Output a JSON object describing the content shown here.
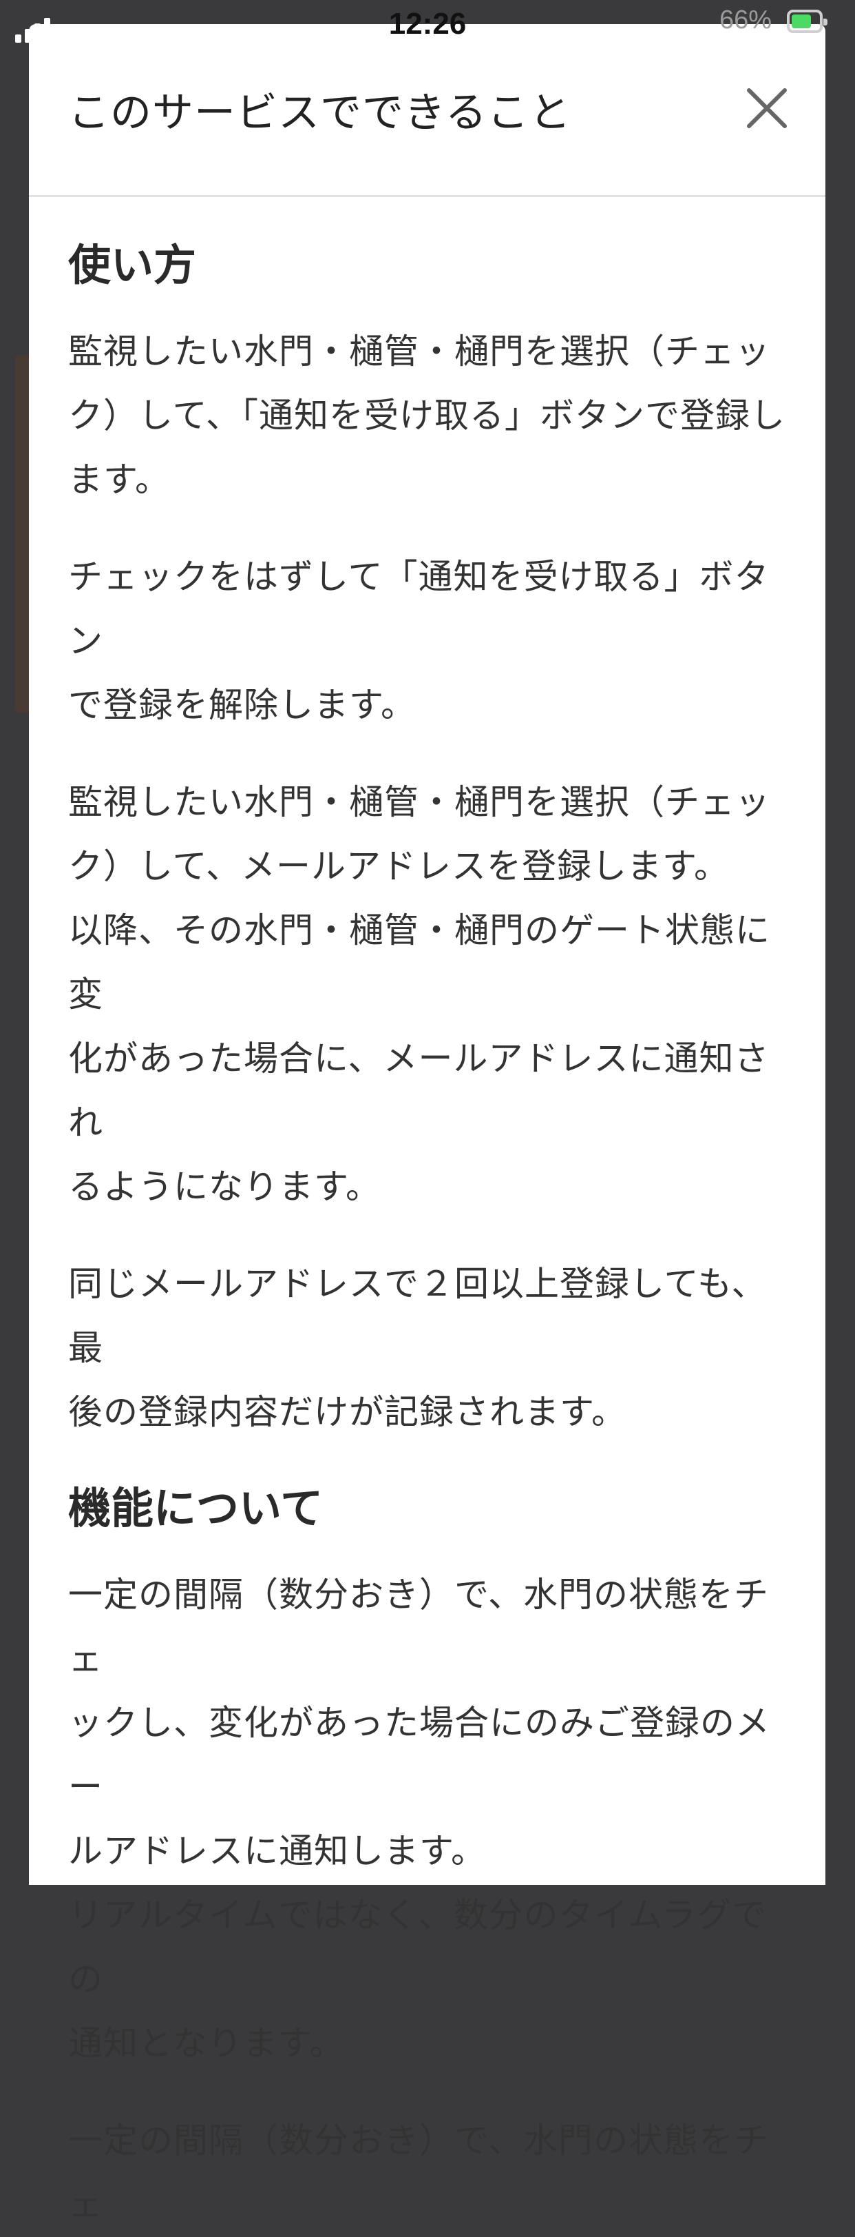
{
  "status_bar": {
    "time": "12:26",
    "battery_percent": "66%"
  },
  "modal": {
    "title": "このサービスでできること",
    "close_icon": "close-icon"
  },
  "sections": [
    {
      "heading": "使い方",
      "paragraphs": [
        "監視したい水門・樋管・樋門を選択（チェッ\nク）して、「通知を受け取る」ボタンで登録し\nます。",
        "チェックをはずして「通知を受け取る」ボタン\nで登録を解除します。",
        "監視したい水門・樋管・樋門を選択（チェッ\nク）して、メールアドレスを登録します。\n以降、その水門・樋管・樋門のゲート状態に変\n化があった場合に、メールアドレスに通知され\nるようになります。",
        "同じメールアドレスで２回以上登録しても、最\n後の登録内容だけが記録されます。"
      ]
    },
    {
      "heading": "機能について",
      "paragraphs": [
        "一定の間隔（数分おき）で、水門の状態をチェ\nックし、変化があった場合にのみご登録のメー\nルアドレスに通知します。\nリアルタイムではなく、数分のタイムラグでの\n通知となります。",
        "一定の間隔（数分おき）で、水門の状態をチェ"
      ]
    }
  ]
}
